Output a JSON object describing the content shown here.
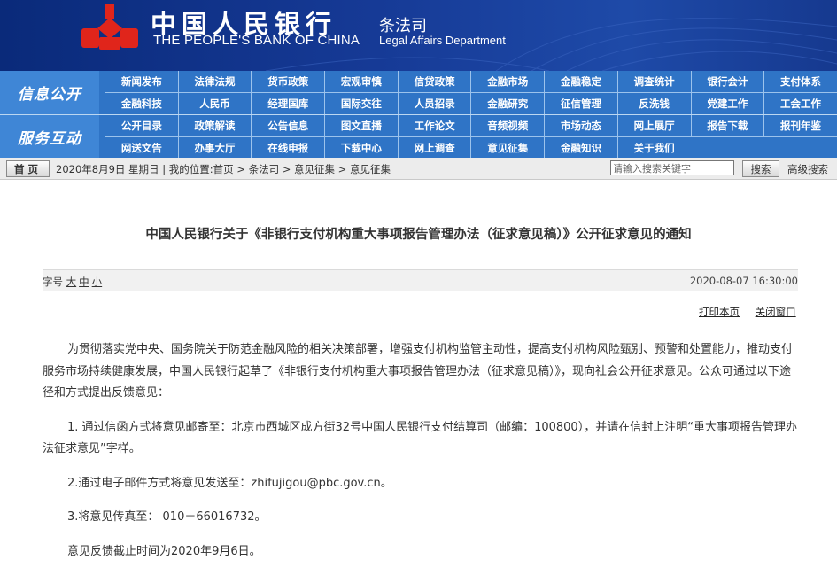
{
  "header": {
    "bank_cn": "中国人民银行",
    "bank_en": "THE PEOPLE'S BANK OF CHINA",
    "dept_cn": "条法司",
    "dept_en": "Legal Affairs Department"
  },
  "nav": {
    "group1": {
      "title": "信息公开",
      "row1": [
        "新闻发布",
        "法律法规",
        "货币政策",
        "宏观审慎",
        "信贷政策",
        "金融市场",
        "金融稳定",
        "调查统计",
        "银行会计",
        "支付体系"
      ],
      "row2": [
        "金融科技",
        "人民币",
        "经理国库",
        "国际交往",
        "人员招录",
        "金融研究",
        "征信管理",
        "反洗钱",
        "党建工作",
        "工会工作"
      ]
    },
    "group2": {
      "title": "服务互动",
      "row1": [
        "公开目录",
        "政策解读",
        "公告信息",
        "图文直播",
        "工作论文",
        "音频视频",
        "市场动态",
        "网上展厅",
        "报告下载",
        "报刊年鉴"
      ],
      "row2": [
        "网送文告",
        "办事大厅",
        "在线申报",
        "下载中心",
        "网上调查",
        "意见征集",
        "金融知识",
        "关于我们"
      ]
    }
  },
  "breadcrumb": {
    "home_label": "首页",
    "date_text": "2020年8月9日 星期日",
    "location_text": "| 我的位置:首页 > 条法司 > 意见征集 > 意见征集",
    "search_placeholder": "请输入搜索关键字",
    "search_button": "搜索",
    "advanced_search": "高级搜索"
  },
  "article": {
    "title": "中国人民银行关于《非银行支付机构重大事项报告管理办法（征求意见稿）》公开征求意见的通知",
    "font_size_label": "字号",
    "font_sizes": [
      "大",
      "中",
      "小"
    ],
    "publish_time": "2020-08-07 16:30:00",
    "print_label": "打印本页",
    "close_label": "关闭窗口",
    "paragraphs": [
      "为贯彻落实党中央、国务院关于防范金融风险的相关决策部署，增强支付机构监管主动性，提高支付机构风险甄别、预警和处置能力，推动支付服务市场持续健康发展，中国人民银行起草了《非银行支付机构重大事项报告管理办法（征求意见稿）》，现向社会公开征求意见。公众可通过以下途径和方式提出反馈意见：",
      "1. 通过信函方式将意见邮寄至：北京市西城区成方街32号中国人民银行支付结算司（邮编：100800），并请在信封上注明“重大事项报告管理办法征求意见”字样。",
      "2.通过电子邮件方式将意见发送至：zhifujigou@pbc.gov.cn。",
      "3.将意见传真至： 010－66016732。",
      "意见反馈截止时间为2020年9月6日。"
    ]
  },
  "colors": {
    "banner_dark": "#0a2a7a",
    "nav_blue": "#2f74c6",
    "logo_red": "#e0251b"
  }
}
